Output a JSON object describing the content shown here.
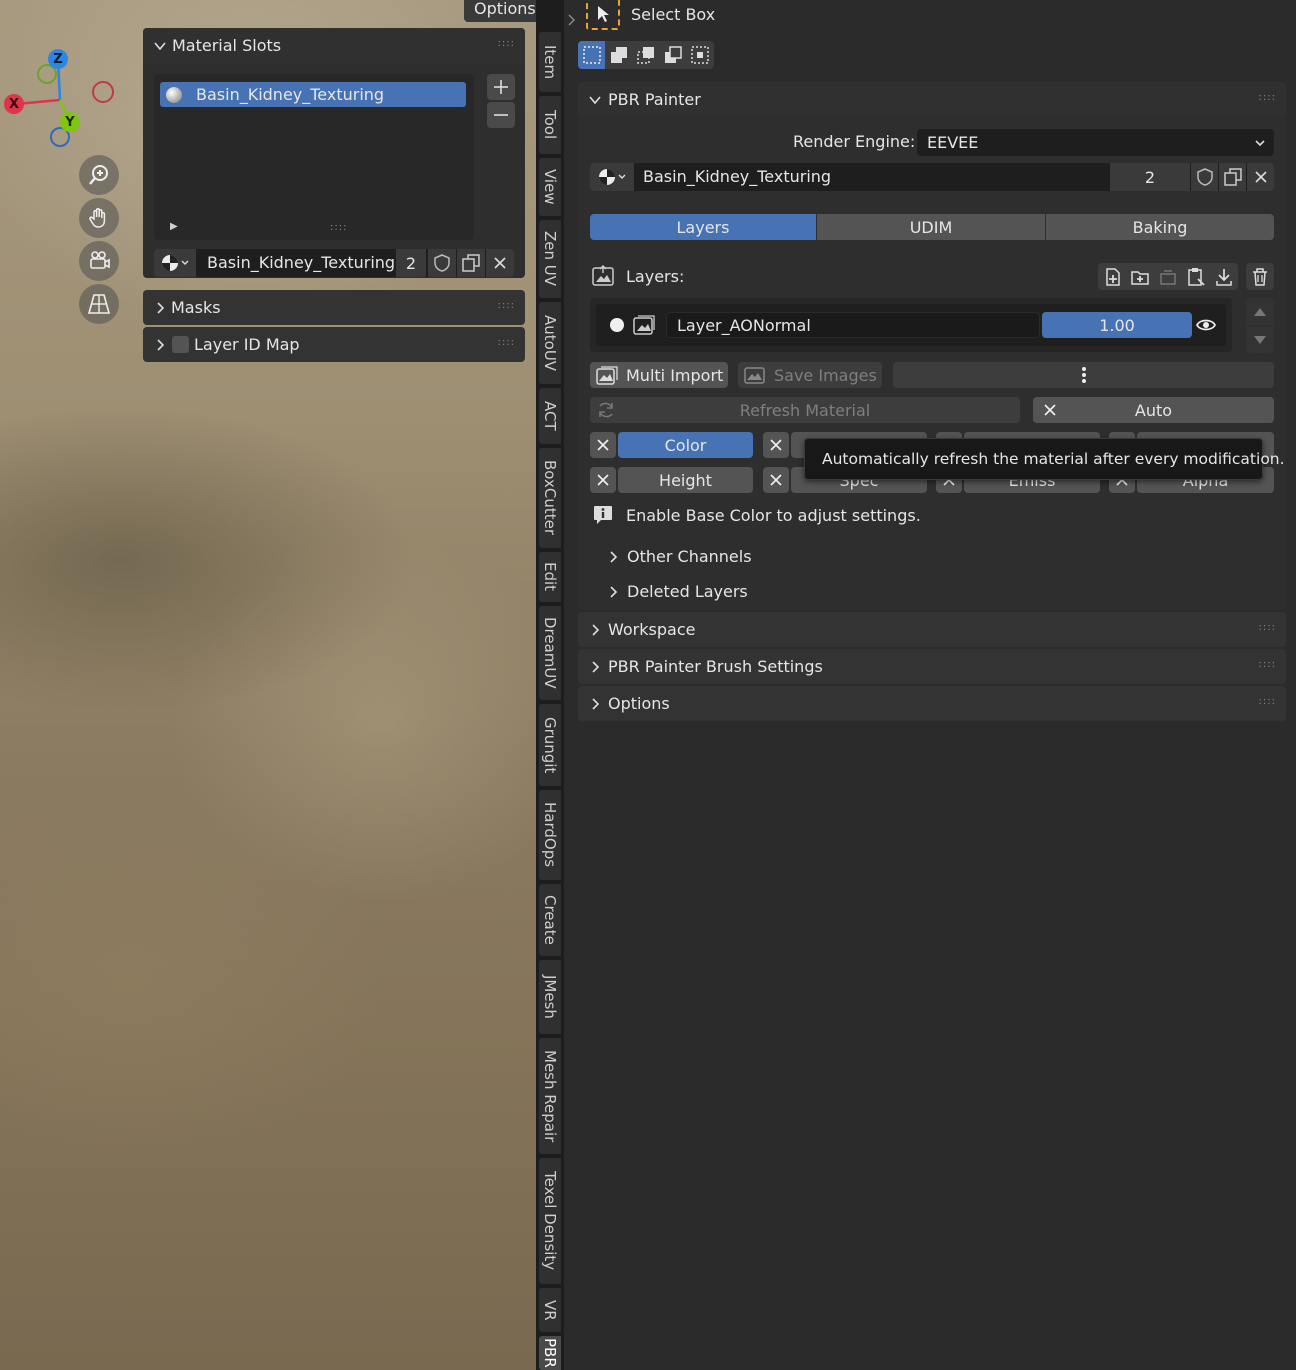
{
  "viewport": {
    "options_label": "Options",
    "gizmo": {
      "x": "X",
      "y": "Y",
      "z": "Z"
    },
    "nav_icons": [
      "zoom-icon",
      "hand-pan-icon",
      "camera-icon",
      "grid-perspective-icon"
    ]
  },
  "material_slots_panel": {
    "title": "Material Slots",
    "slot_name": "Basin_Kidney_Texturing",
    "material_name": "Basin_Kidney_Texturing",
    "user_count": "2"
  },
  "masks_panel": {
    "title": "Masks"
  },
  "layer_id_map_panel": {
    "title": "Layer ID Map"
  },
  "tabs": [
    "Item",
    "Tool",
    "View",
    "Zen UV",
    "AutoUV",
    "ACT",
    "BoxCutter",
    "Edit",
    "DreamUV",
    "Grungit",
    "HardOps",
    "Create",
    "JMesh",
    "Mesh Repair",
    "Texel Density",
    "VR",
    "PBR"
  ],
  "toolbar": {
    "tool_name": "Select Box"
  },
  "pbr_painter": {
    "title": "PBR Painter",
    "render_engine_label": "Render Engine:",
    "render_engine_value": "EEVEE",
    "material_name": "Basin_Kidney_Texturing",
    "user_count": "2",
    "mode_tabs": [
      "Layers",
      "UDIM",
      "Baking"
    ],
    "layers_label": "Layers:",
    "layer": {
      "name": "Layer_AONormal",
      "opacity": "1.00"
    },
    "multi_import_label": "Multi Import",
    "save_images_label": "Save Images",
    "refresh_material_label": "Refresh Material",
    "auto_label": "Auto",
    "channels_row1": [
      "Color",
      "",
      "",
      ""
    ],
    "channels_row2": [
      "Height",
      "Spec",
      "Emiss",
      "Alpha"
    ],
    "info_text": "Enable Base Color to adjust settings.",
    "other_channels_label": "Other Channels",
    "deleted_layers_label": "Deleted Layers",
    "tooltip": "Automatically refresh the material after every modification."
  },
  "workspace_panel": {
    "title": "Workspace"
  },
  "brush_settings_panel": {
    "title": "PBR Painter Brush Settings"
  },
  "options_panel": {
    "title": "Options"
  },
  "colors": {
    "accent_blue": "#4772b3",
    "axis_x": "#e0344a",
    "axis_y": "#7fc512",
    "axis_z": "#2e86e3",
    "tool_yellow": "#e8a53c"
  }
}
